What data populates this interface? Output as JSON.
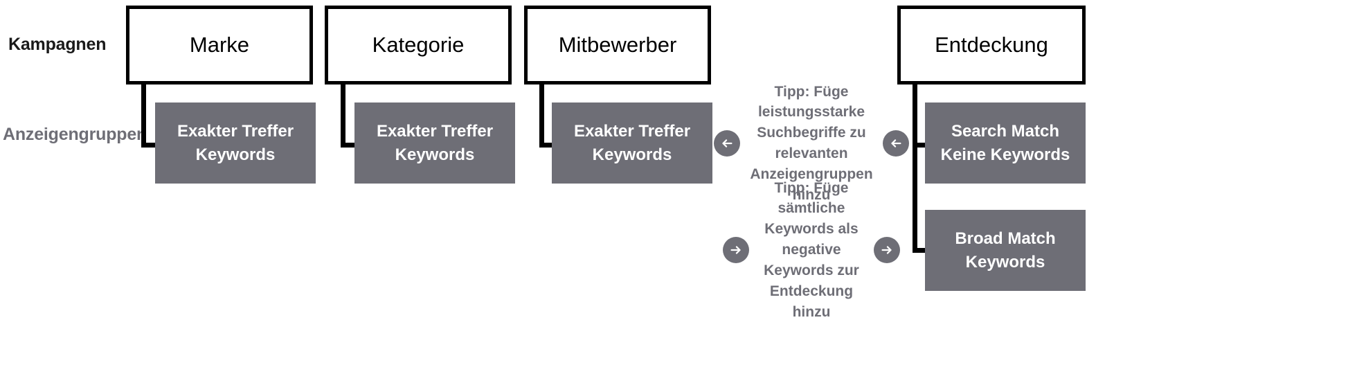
{
  "row_labels": {
    "campaigns": "Kampagnen",
    "adgroups": "Anzeigengruppen"
  },
  "colors": {
    "campaign_border": "#000000",
    "campaign_fill": "#ffffff",
    "adgroup_fill": "#6e6e76",
    "adgroup_text": "#ffffff",
    "tip_text": "#6e6e76",
    "label_text": "#6e6e76",
    "connector": "#000000"
  },
  "campaigns": [
    {
      "name": "Marke"
    },
    {
      "name": "Kategorie"
    },
    {
      "name": "Mitbewerber"
    },
    {
      "name": "Entdeckung"
    }
  ],
  "adgroups": [
    {
      "line1": "Exakter Treffer",
      "line2": "Keywords"
    },
    {
      "line1": "Exakter Treffer",
      "line2": "Keywords"
    },
    {
      "line1": "Exakter Treffer",
      "line2": "Keywords"
    },
    {
      "line1": "Search Match",
      "line2": "Keine Keywords"
    },
    {
      "line1": "Broad Match",
      "line2": "Keywords"
    }
  ],
  "tips": [
    {
      "text": "Tipp: Füge leistungsstarke Suchbegriffe zu relevanten Anzeigengruppen hinzu",
      "direction": "left",
      "icon_left": "arrow-left-icon",
      "icon_right": "arrow-left-icon"
    },
    {
      "text": "Tipp: Füge sämtliche Keywords als negative Keywords zur Entdeckung hinzu",
      "direction": "right",
      "icon_left": "arrow-right-icon",
      "icon_right": "arrow-right-icon"
    }
  ]
}
